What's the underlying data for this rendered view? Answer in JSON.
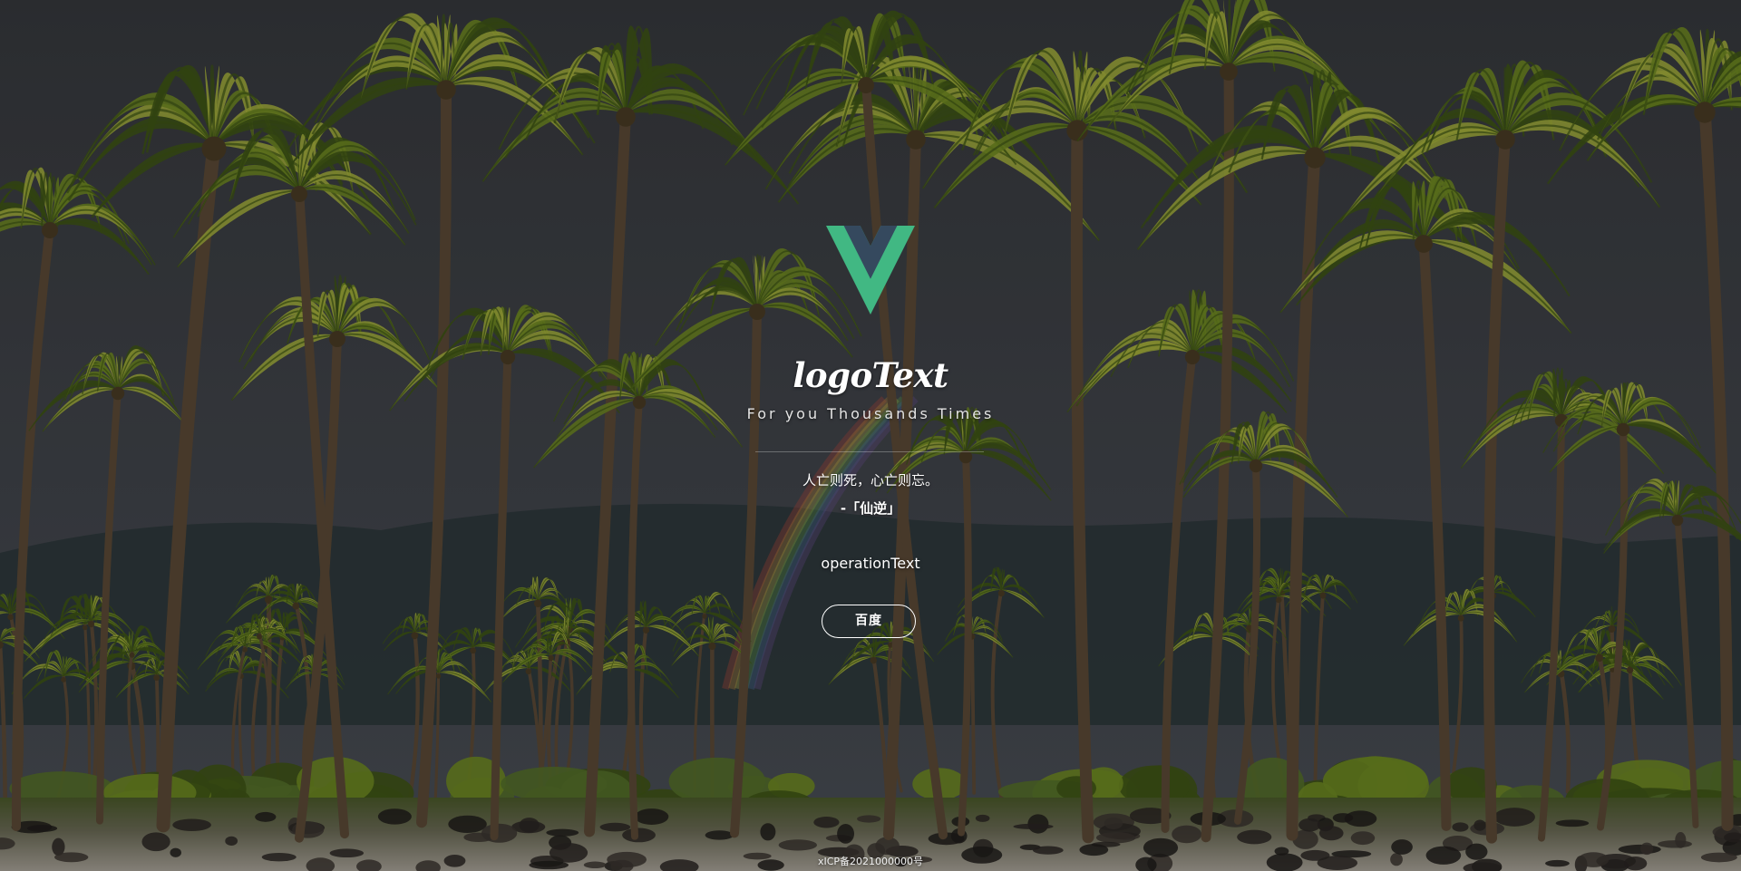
{
  "background": {
    "icon": "palm-beach-photo",
    "colors": {
      "sky_top": "#37393d",
      "sky_bottom": "#4a4f57",
      "mountain": "#2e393c",
      "foliage_dark": "#3f5516",
      "foliage": "#6f8a22",
      "foliage_light": "#a5b03c",
      "trunk": "#5b4a36",
      "ground": "#9d978d"
    }
  },
  "logo": {
    "icon": "vue-logo-icon",
    "text": "logoText",
    "colors": {
      "outer": "#41b883",
      "inner": "#35495e"
    }
  },
  "tagline": "For you Thousands Times",
  "quote": {
    "text": "人亡则死，心亡则忘。",
    "source": "-「仙逆」"
  },
  "operation_text": "operationText",
  "buttons": [
    {
      "label": "百度"
    }
  ],
  "footer": {
    "icp": "xICP备2021000000号"
  }
}
